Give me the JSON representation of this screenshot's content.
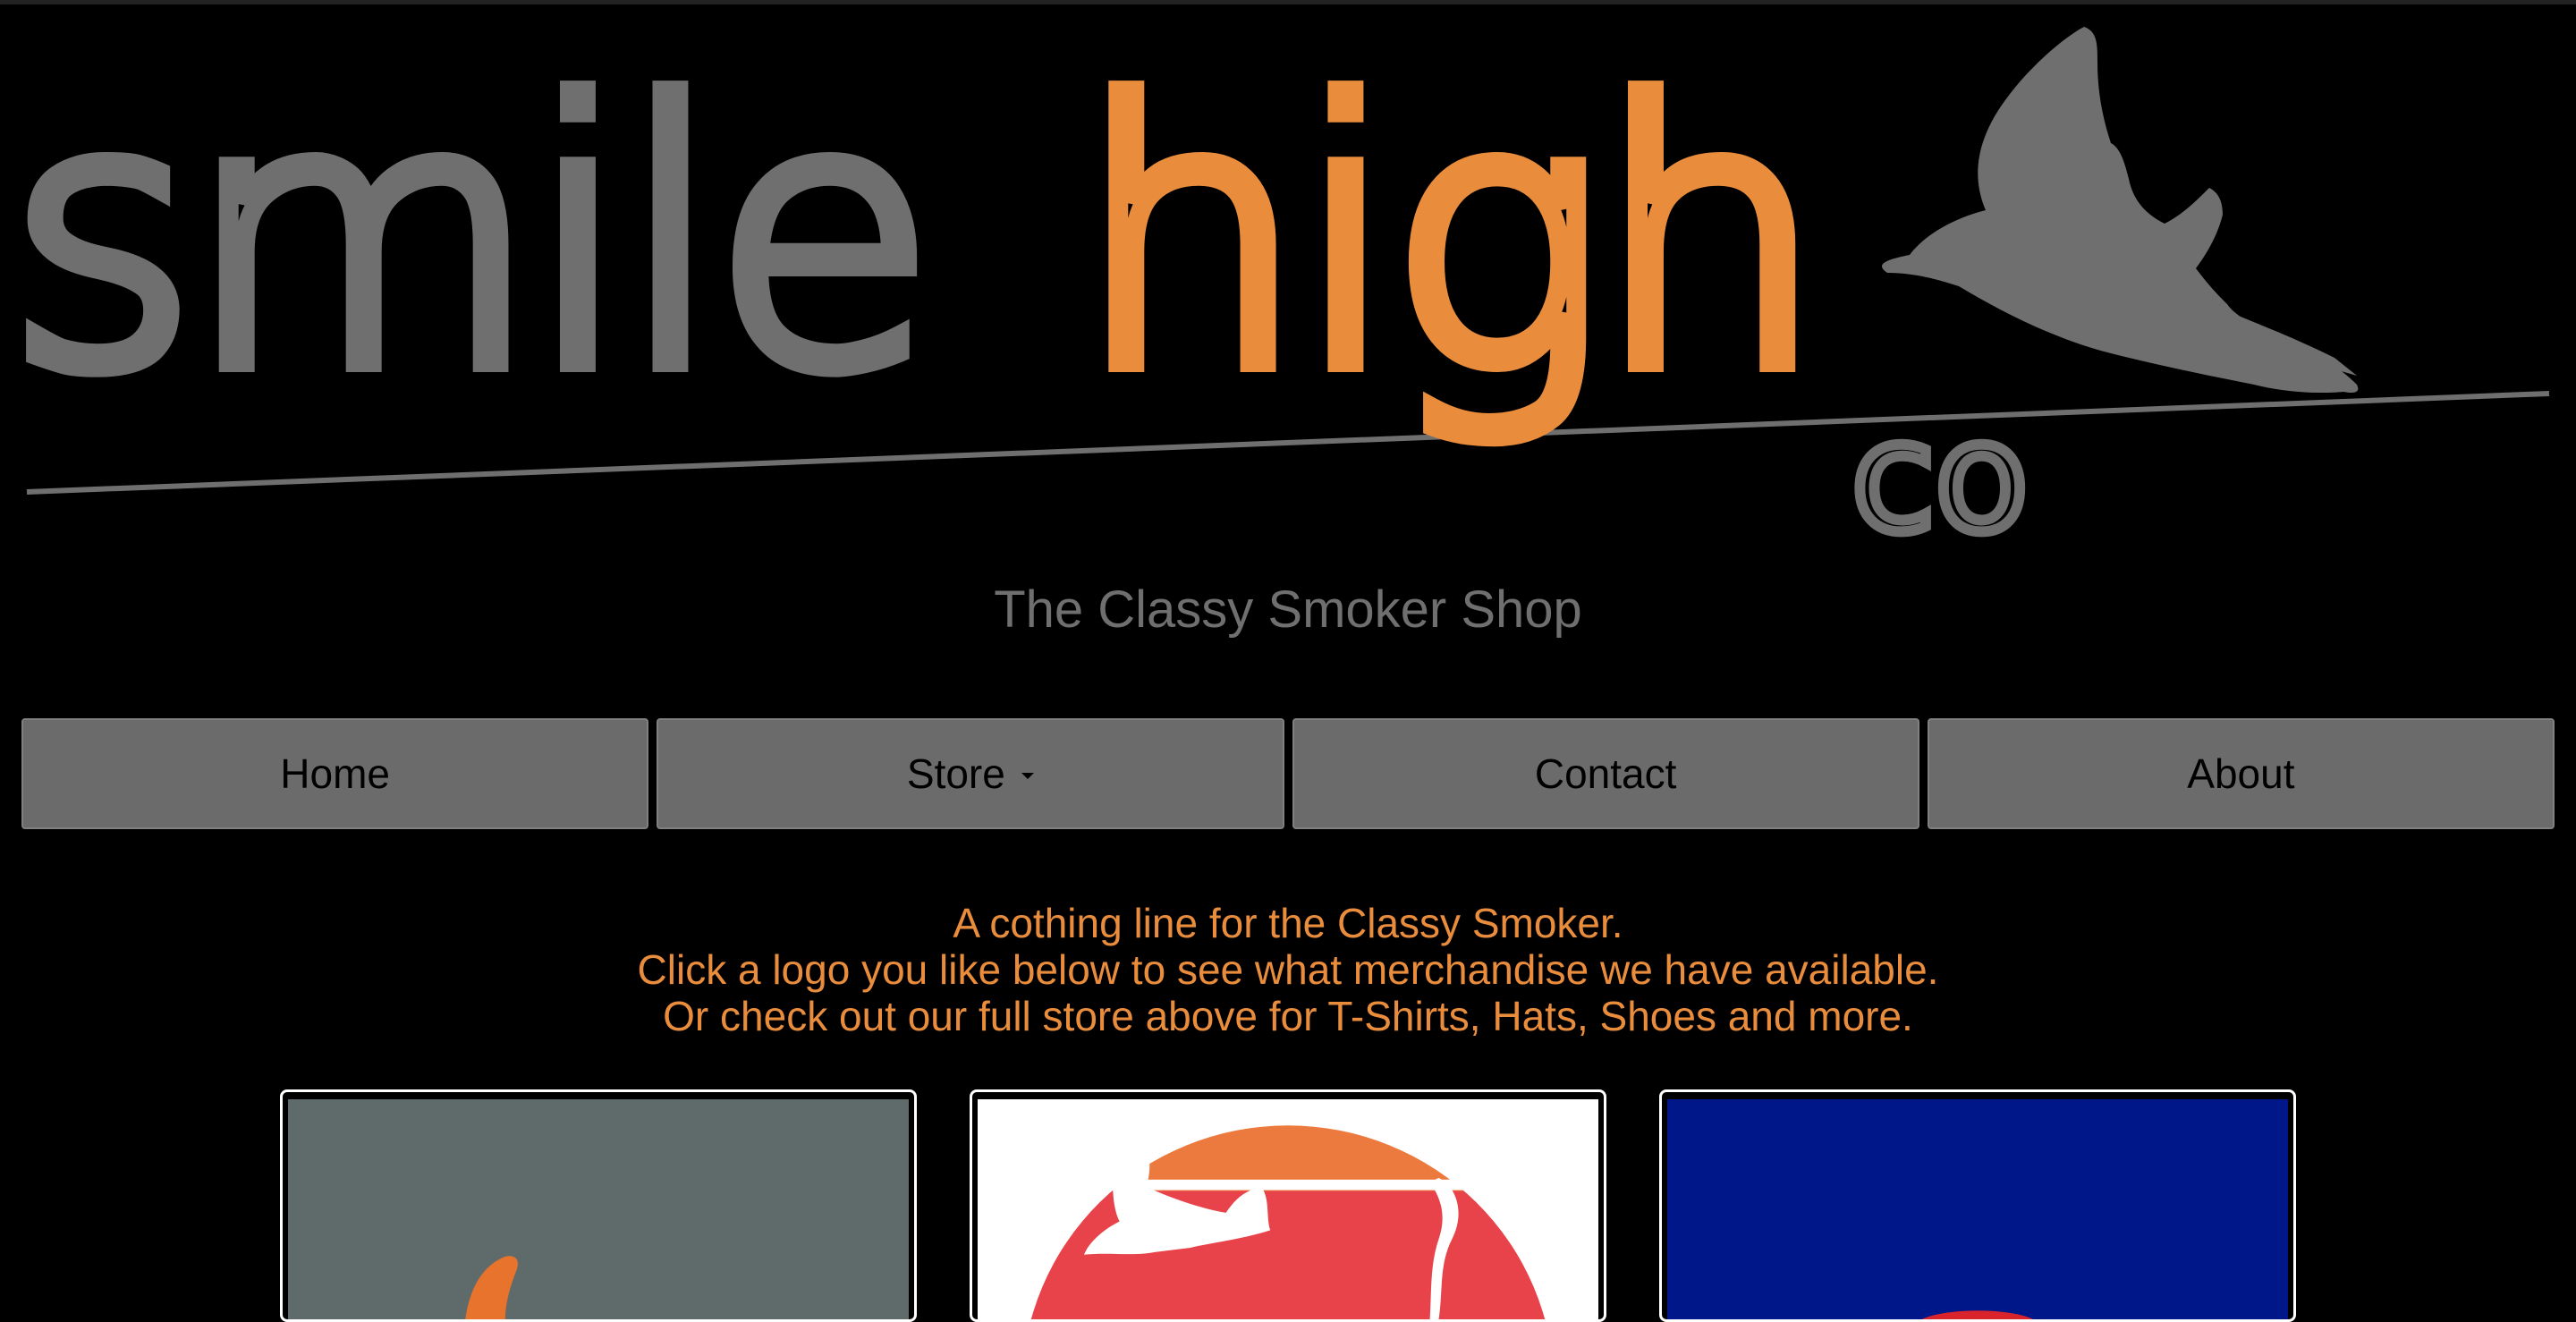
{
  "brand": {
    "logo_text_part1": "smile",
    "logo_text_part2": "high",
    "logo_suffix": "co",
    "tagline": "The Classy Smoker Shop",
    "colors": {
      "gray": "#6f6f6f",
      "orange": "#e98d3d",
      "background": "#000000"
    }
  },
  "nav": {
    "items": [
      {
        "label": "Home",
        "has_dropdown": false
      },
      {
        "label": "Store",
        "has_dropdown": true
      },
      {
        "label": "Contact",
        "has_dropdown": false
      },
      {
        "label": "About",
        "has_dropdown": false
      }
    ]
  },
  "intro": {
    "line1": "A cothing line for the Classy Smoker.",
    "line2": "Click a logo you like below to see what merchandise we have available.",
    "line3": "Or check out our full store above for T-Shirts, Hats, Shoes and more."
  },
  "tiles": [
    {
      "name": "gray-logo",
      "background": "#5f6b6b"
    },
    {
      "name": "sunset-logo",
      "background": "#ffffff"
    },
    {
      "name": "blue-logo",
      "background": "#00178a"
    }
  ]
}
